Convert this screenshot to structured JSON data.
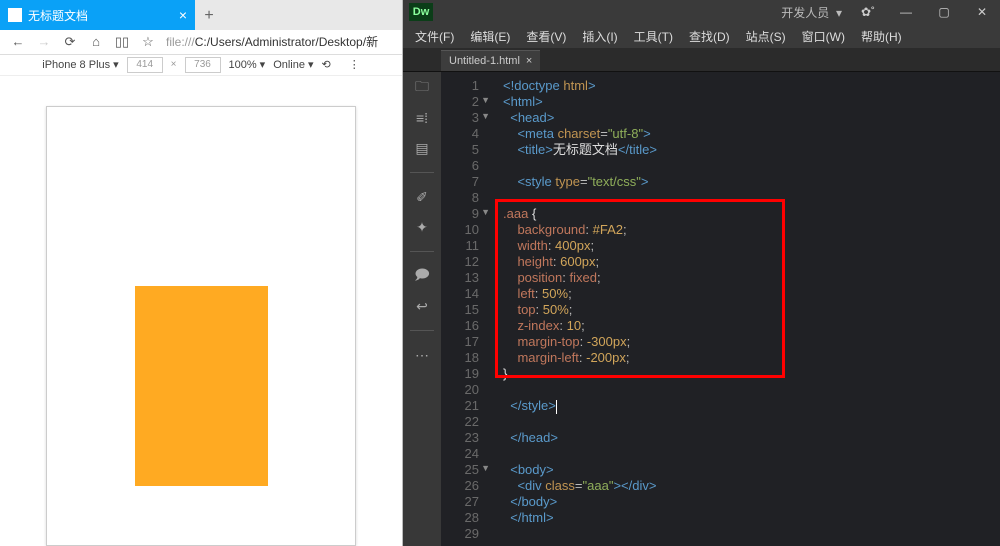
{
  "browser": {
    "tab_title": "无标题文档",
    "url_prefix": "file:///",
    "url": "C:/Users/Administrator/Desktop/新",
    "device": "iPhone 8 Plus",
    "width": "414",
    "height": "736",
    "zoom": "100%",
    "online": "Online"
  },
  "dw": {
    "logo": "Dw",
    "layout": "开发人员",
    "menu": [
      "文件(F)",
      "编辑(E)",
      "查看(V)",
      "插入(I)",
      "工具(T)",
      "查找(D)",
      "站点(S)",
      "窗口(W)",
      "帮助(H)"
    ],
    "file_tab": "Untitled-1.html"
  },
  "code": {
    "lines": [
      {
        "n": "1",
        "f": "",
        "h": "<span class='br'>&lt;!</span><span class='tag'>doctype</span> <span class='attr'>html</span><span class='br'>&gt;</span>"
      },
      {
        "n": "2",
        "f": "▼",
        "h": "<span class='br'>&lt;</span><span class='tag'>html</span><span class='br'>&gt;</span>"
      },
      {
        "n": "3",
        "f": "▼",
        "h": "  <span class='br'>&lt;</span><span class='tag'>head</span><span class='br'>&gt;</span>"
      },
      {
        "n": "4",
        "f": "",
        "h": "    <span class='br'>&lt;</span><span class='tag'>meta</span> <span class='attr'>charset</span>=<span class='val'>\"utf-8\"</span><span class='br'>&gt;</span>"
      },
      {
        "n": "5",
        "f": "",
        "h": "    <span class='br'>&lt;</span><span class='tag'>title</span><span class='br'>&gt;</span><span class='txt'>无标题文档</span><span class='br'>&lt;/</span><span class='tag'>title</span><span class='br'>&gt;</span>"
      },
      {
        "n": "6",
        "f": "",
        "h": ""
      },
      {
        "n": "7",
        "f": "",
        "h": "    <span class='br'>&lt;</span><span class='tag'>style</span> <span class='attr'>type</span>=<span class='val'>\"text/css\"</span><span class='br'>&gt;</span>"
      },
      {
        "n": "8",
        "f": "",
        "h": ""
      },
      {
        "n": "9",
        "f": "▼",
        "h": "<span class='sel'>.aaa</span> <span class='txt'>{</span>"
      },
      {
        "n": "10",
        "f": "",
        "h": "    <span class='prop'>background</span>: <span class='num'>#FA2</span>;"
      },
      {
        "n": "11",
        "f": "",
        "h": "    <span class='prop'>width</span>: <span class='num'>400px</span>;"
      },
      {
        "n": "12",
        "f": "",
        "h": "    <span class='prop'>height</span>: <span class='num'>600px</span>;"
      },
      {
        "n": "13",
        "f": "",
        "h": "    <span class='prop'>position</span>: <span class='kw'>fixed</span>;"
      },
      {
        "n": "14",
        "f": "",
        "h": "    <span class='prop'>left</span>: <span class='num'>50%</span>;"
      },
      {
        "n": "15",
        "f": "",
        "h": "    <span class='prop'>top</span>: <span class='num'>50%</span>;"
      },
      {
        "n": "16",
        "f": "",
        "h": "    <span class='prop'>z-index</span>: <span class='num'>10</span>;"
      },
      {
        "n": "17",
        "f": "",
        "h": "    <span class='prop'>margin-top</span>: <span class='num'>-300px</span>;"
      },
      {
        "n": "18",
        "f": "",
        "h": "    <span class='prop'>margin-left</span>: <span class='num'>-200px</span>;"
      },
      {
        "n": "19",
        "f": "",
        "h": "<span class='txt'>}</span>"
      },
      {
        "n": "20",
        "f": "",
        "h": ""
      },
      {
        "n": "21",
        "f": "",
        "h": "  <span class='br'>&lt;/</span><span class='tag'>style</span><span class='br'>&gt;</span><span class='cursor'></span>"
      },
      {
        "n": "22",
        "f": "",
        "h": ""
      },
      {
        "n": "23",
        "f": "",
        "h": "  <span class='br'>&lt;/</span><span class='tag'>head</span><span class='br'>&gt;</span>"
      },
      {
        "n": "24",
        "f": "",
        "h": ""
      },
      {
        "n": "25",
        "f": "▼",
        "h": "  <span class='br'>&lt;</span><span class='tag'>body</span><span class='br'>&gt;</span>"
      },
      {
        "n": "26",
        "f": "",
        "h": "    <span class='br'>&lt;</span><span class='tag'>div</span> <span class='attr'>class</span>=<span class='val'>\"aaa\"</span><span class='br'>&gt;&lt;/</span><span class='tag'>div</span><span class='br'>&gt;</span>"
      },
      {
        "n": "27",
        "f": "",
        "h": "  <span class='br'>&lt;/</span><span class='tag'>body</span><span class='br'>&gt;</span>"
      },
      {
        "n": "28",
        "f": "",
        "h": "  <span class='br'>&lt;/</span><span class='tag'>html</span><span class='br'>&gt;</span>"
      },
      {
        "n": "29",
        "f": "",
        "h": ""
      }
    ]
  }
}
